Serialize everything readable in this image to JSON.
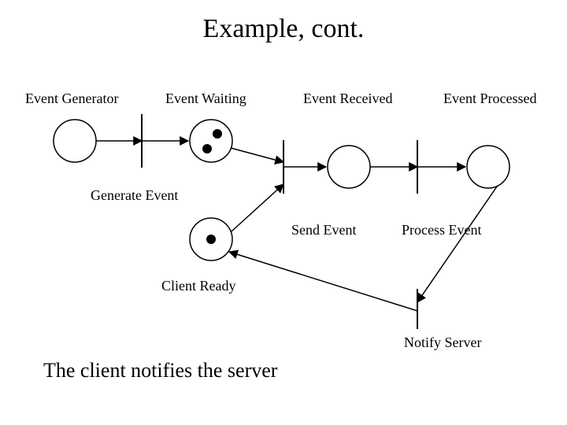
{
  "title": "Example, cont.",
  "labels": {
    "event_generator": "Event Generator",
    "event_waiting": "Event Waiting",
    "event_received": "Event Received",
    "event_processed": "Event Processed",
    "generate_event": "Generate Event",
    "send_event": "Send Event",
    "process_event": "Process Event",
    "client_ready": "Client Ready",
    "notify_server": "Notify Server"
  },
  "caption": "The client notifies the server",
  "diagram": {
    "type": "petri-net",
    "places": [
      {
        "id": "event_generator",
        "tokens": 0
      },
      {
        "id": "event_waiting",
        "tokens": 2
      },
      {
        "id": "event_received",
        "tokens": 0
      },
      {
        "id": "event_processed",
        "tokens": 0
      },
      {
        "id": "client_ready",
        "tokens": 1
      }
    ],
    "transitions": [
      "generate_event",
      "send_event",
      "process_event",
      "notify_server"
    ],
    "arcs": [
      {
        "from": "event_generator",
        "to": "generate_event"
      },
      {
        "from": "generate_event",
        "to": "event_waiting"
      },
      {
        "from": "event_waiting",
        "to": "send_event"
      },
      {
        "from": "client_ready",
        "to": "send_event"
      },
      {
        "from": "send_event",
        "to": "event_received"
      },
      {
        "from": "event_received",
        "to": "process_event"
      },
      {
        "from": "process_event",
        "to": "event_processed"
      },
      {
        "from": "event_processed",
        "to": "notify_server"
      },
      {
        "from": "notify_server",
        "to": "client_ready"
      }
    ]
  }
}
